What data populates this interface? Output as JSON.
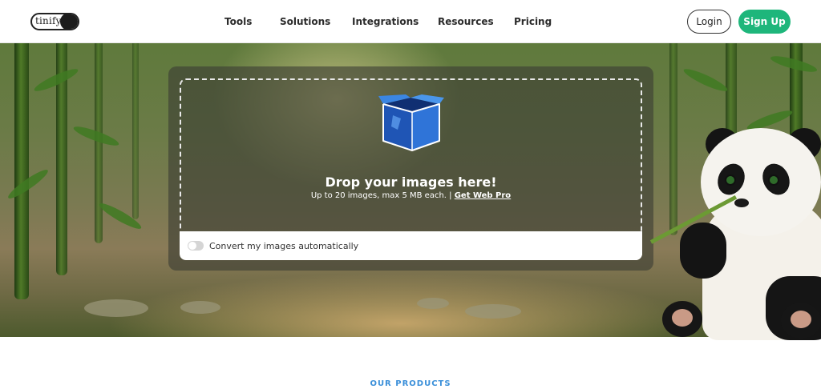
{
  "brand": {
    "logo_text": "tinify"
  },
  "nav": {
    "items": [
      {
        "label": "Tools"
      },
      {
        "label": "Solutions"
      },
      {
        "label": "Integrations"
      },
      {
        "label": "Resources"
      },
      {
        "label": "Pricing"
      }
    ]
  },
  "auth": {
    "login_label": "Login",
    "signup_label": "Sign Up",
    "signup_color": "#1eb67b"
  },
  "upload": {
    "title": "Drop your images here!",
    "subtitle": "Up to 20 images, max 5 MB each. |",
    "pro_link": "Get Web Pro",
    "convert_label": "Convert my images automatically",
    "convert_enabled": false
  },
  "products": {
    "section_label": "OUR PRODUCTS",
    "accent_color": "#3a8fd9"
  },
  "icons": {
    "upload_box": "box-icon",
    "toggle": "toggle-switch"
  }
}
